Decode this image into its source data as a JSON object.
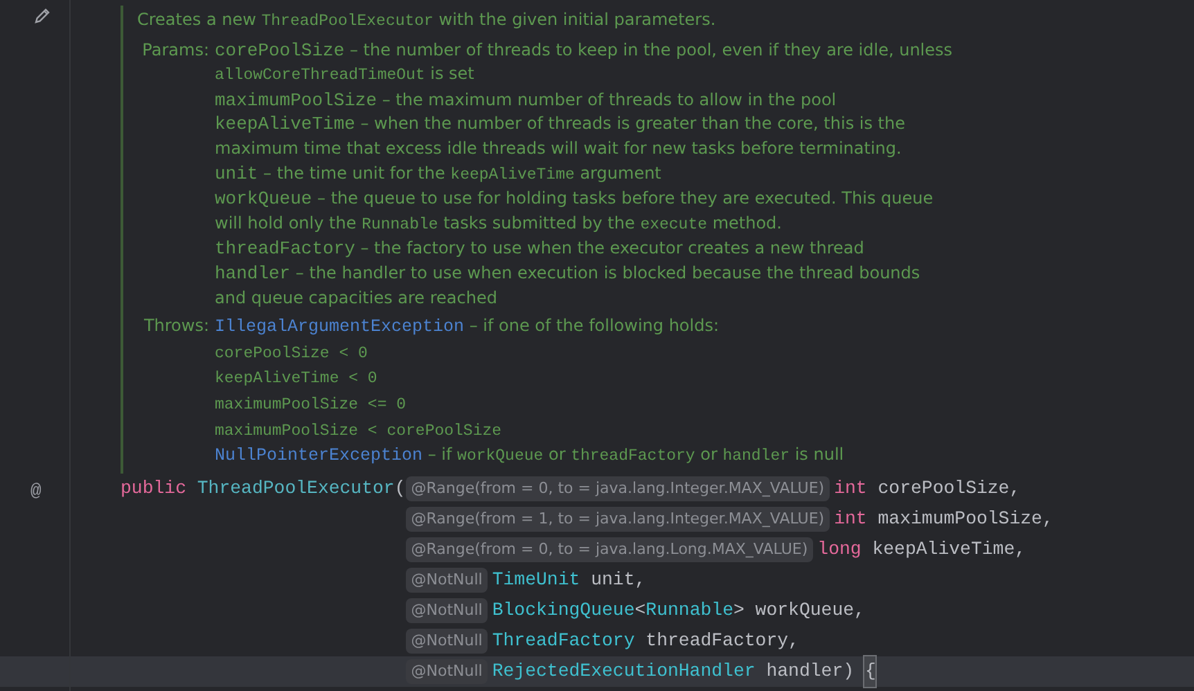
{
  "doc": {
    "summary": [
      {
        "kind": "text",
        "text": "Creates a new "
      },
      {
        "kind": "code",
        "text": "ThreadPoolExecutor"
      },
      {
        "kind": "text",
        "text": " with the given initial parameters."
      }
    ],
    "sections": [
      {
        "label": "Params:",
        "lines": [
          [
            {
              "kind": "param",
              "text": "corePoolSize"
            },
            {
              "kind": "text",
              "text": " – the number of threads to keep in the pool, even if they are idle, unless"
            }
          ],
          [
            {
              "kind": "code",
              "text": "allowCoreThreadTimeOut"
            },
            {
              "kind": "text",
              "text": " is set"
            }
          ],
          [
            {
              "kind": "param",
              "text": "maximumPoolSize"
            },
            {
              "kind": "text",
              "text": " – the maximum number of threads to allow in the pool"
            }
          ],
          [
            {
              "kind": "param",
              "text": "keepAliveTime"
            },
            {
              "kind": "text",
              "text": " – when the number of threads is greater than the core, this is the"
            }
          ],
          [
            {
              "kind": "text",
              "text": "maximum time that excess idle threads will wait for new tasks before terminating."
            }
          ],
          [
            {
              "kind": "param",
              "text": "unit"
            },
            {
              "kind": "text",
              "text": " – the time unit for the "
            },
            {
              "kind": "code",
              "text": "keepAliveTime"
            },
            {
              "kind": "text",
              "text": " argument"
            }
          ],
          [
            {
              "kind": "param",
              "text": "workQueue"
            },
            {
              "kind": "text",
              "text": " – the queue to use for holding tasks before they are executed. This queue"
            }
          ],
          [
            {
              "kind": "text",
              "text": "will hold only the "
            },
            {
              "kind": "code",
              "text": "Runnable"
            },
            {
              "kind": "text",
              "text": " tasks submitted by the "
            },
            {
              "kind": "code",
              "text": "execute"
            },
            {
              "kind": "text",
              "text": " method."
            }
          ],
          [
            {
              "kind": "param",
              "text": "threadFactory"
            },
            {
              "kind": "text",
              "text": " – the factory to use when the executor creates a new thread"
            }
          ],
          [
            {
              "kind": "param",
              "text": "handler"
            },
            {
              "kind": "text",
              "text": " – the handler to use when execution is blocked because the thread bounds"
            }
          ],
          [
            {
              "kind": "text",
              "text": "and queue capacities are reached"
            }
          ]
        ]
      },
      {
        "label": "Throws:",
        "lines": [
          [
            {
              "kind": "link",
              "text": "IllegalArgumentException"
            },
            {
              "kind": "text",
              "text": " – if one of the following holds:"
            }
          ],
          [
            {
              "kind": "code",
              "text": "corePoolSize < 0"
            }
          ],
          [
            {
              "kind": "code",
              "text": "keepAliveTime < 0"
            }
          ],
          [
            {
              "kind": "code",
              "text": "maximumPoolSize <= 0"
            }
          ],
          [
            {
              "kind": "code",
              "text": "maximumPoolSize < corePoolSize"
            }
          ],
          [
            {
              "kind": "link",
              "text": "NullPointerException"
            },
            {
              "kind": "text",
              "text": " – if "
            },
            {
              "kind": "code",
              "text": "workQueue"
            },
            {
              "kind": "text",
              "text": " or "
            },
            {
              "kind": "code",
              "text": "threadFactory"
            },
            {
              "kind": "text",
              "text": " or "
            },
            {
              "kind": "code",
              "text": "handler"
            },
            {
              "kind": "text",
              "text": " is null"
            }
          ]
        ]
      }
    ]
  },
  "code_lines": [
    {
      "gutter": "@",
      "current": false,
      "prefix": [
        {
          "kind": "keyword",
          "text": "public"
        },
        {
          "kind": "method",
          "text": "ThreadPoolExecutor"
        },
        {
          "kind": "plain",
          "text": "("
        }
      ],
      "tokens": [
        {
          "kind": "hint",
          "text": "@Range(from = 0, to = java.lang.Integer.MAX_VALUE)"
        },
        {
          "kind": "keyword",
          "text": "int"
        },
        {
          "kind": "plain",
          "text": " corePoolSize,"
        }
      ]
    },
    {
      "current": false,
      "tokens": [
        {
          "kind": "hint",
          "text": "@Range(from = 1, to = java.lang.Integer.MAX_VALUE)"
        },
        {
          "kind": "keyword",
          "text": "int"
        },
        {
          "kind": "plain",
          "text": " maximumPoolSize,"
        }
      ]
    },
    {
      "current": false,
      "tokens": [
        {
          "kind": "hint",
          "text": "@Range(from = 0, to = java.lang.Long.MAX_VALUE)"
        },
        {
          "kind": "keyword",
          "text": "long"
        },
        {
          "kind": "plain",
          "text": " keepAliveTime,"
        }
      ]
    },
    {
      "current": false,
      "tokens": [
        {
          "kind": "hint",
          "text": "@NotNull"
        },
        {
          "kind": "type",
          "text": "TimeUnit"
        },
        {
          "kind": "plain",
          "text": " unit,"
        }
      ]
    },
    {
      "current": false,
      "tokens": [
        {
          "kind": "hint",
          "text": "@NotNull"
        },
        {
          "kind": "type",
          "text": "BlockingQueue"
        },
        {
          "kind": "plain",
          "text": "<"
        },
        {
          "kind": "type",
          "text": "Runnable"
        },
        {
          "kind": "plain",
          "text": "> workQueue,"
        }
      ]
    },
    {
      "current": false,
      "tokens": [
        {
          "kind": "hint",
          "text": "@NotNull"
        },
        {
          "kind": "type",
          "text": "ThreadFactory"
        },
        {
          "kind": "plain",
          "text": " threadFactory,"
        }
      ]
    },
    {
      "current": true,
      "tokens": [
        {
          "kind": "hint",
          "text": "@NotNull"
        },
        {
          "kind": "type",
          "text": "RejectedExecutionHandler"
        },
        {
          "kind": "plain",
          "text": " handler)"
        },
        {
          "kind": "brace",
          "text": "{"
        }
      ]
    }
  ]
}
